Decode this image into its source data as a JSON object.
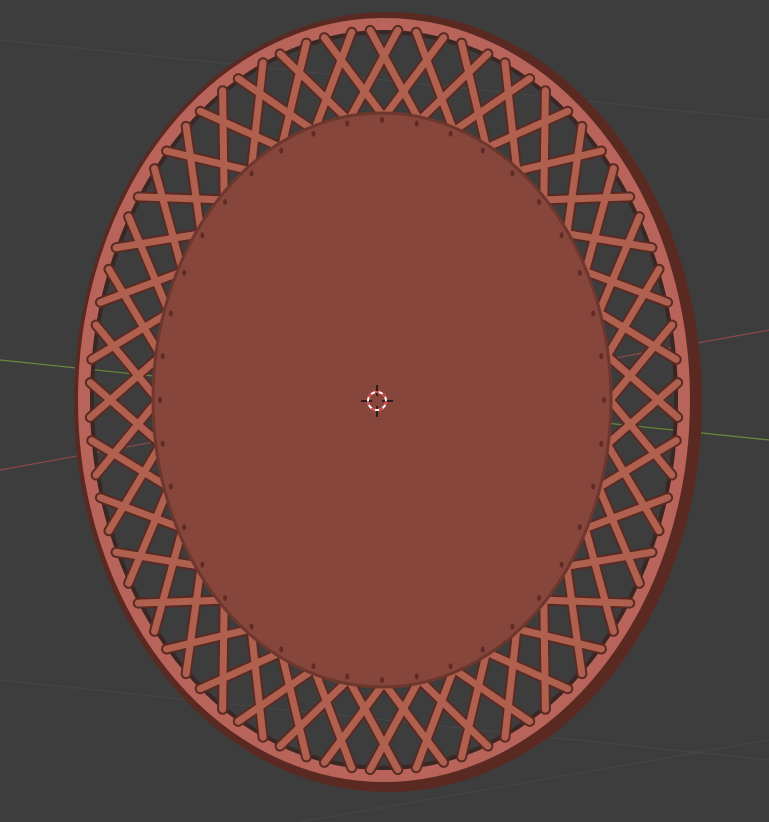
{
  "viewport": {
    "background_color": "#3d3d3d",
    "grid_color": "#4a4a4a",
    "x_axis_color": "#8a4a4a",
    "y_axis_color": "#6a8a3a"
  },
  "model": {
    "name_icon": "mesh-object",
    "rim_color": "#b8645a",
    "lattice_color": "#b0604f",
    "lattice_shadow_color": "#5a2a22",
    "disk_color": "#86463b",
    "lattice_strut_pairs": 40
  },
  "cursor": {
    "icon": "3d-cursor-icon",
    "ring_color": "#ffffff",
    "dash_color": "#e04040"
  }
}
